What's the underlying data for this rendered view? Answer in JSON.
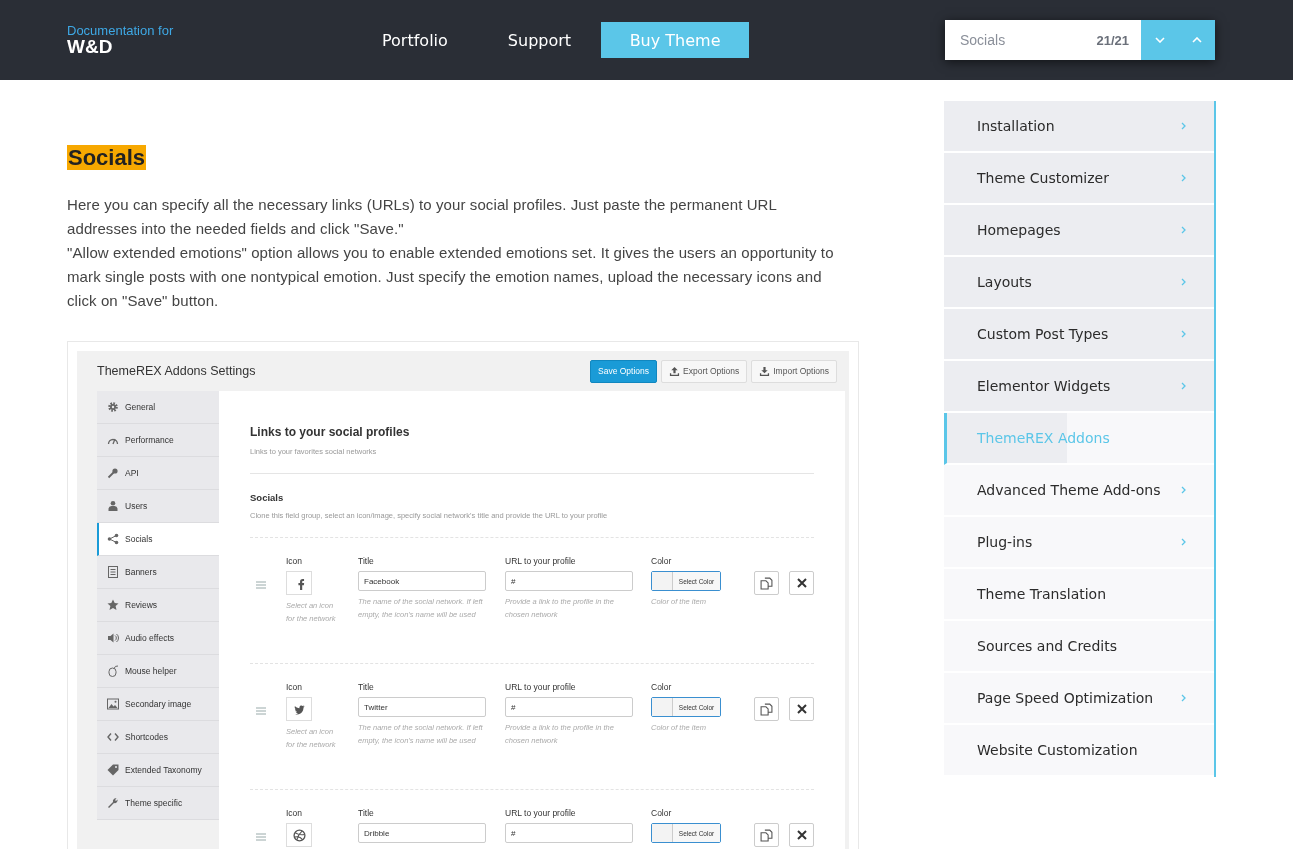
{
  "header": {
    "logo": {
      "caption": "Documentation for",
      "name": "W&D"
    },
    "nav": [
      {
        "label": "Portfolio",
        "kind": "link"
      },
      {
        "label": "Support",
        "kind": "link"
      },
      {
        "label": "Buy Theme",
        "kind": "button"
      }
    ],
    "search": {
      "value": "Socials",
      "count": "21/21"
    }
  },
  "article": {
    "heading": "Socials",
    "paragraphs": [
      "Here you can specify all the necessary links (URLs) to your social profiles. Just paste the permanent URL addresses into the needed fields and click \"Save.\"",
      "\"Allow extended emotions\" option allows you to enable extended emotions set. It gives the users an opportunity to mark single posts with one nontypical emotion. Just specify the emotion names, upload the necessary icons and click on \"Save\" button."
    ]
  },
  "settings": {
    "title": "ThemeREX Addons Settings",
    "buttons": [
      {
        "label": "Save Options",
        "kind": "primary"
      },
      {
        "label": "Export Options",
        "kind": "export"
      },
      {
        "label": "Import Options",
        "kind": "import"
      }
    ],
    "menu": [
      {
        "label": "General",
        "selected": false
      },
      {
        "label": "Performance",
        "selected": false
      },
      {
        "label": "API",
        "selected": false
      },
      {
        "label": "Users",
        "selected": false
      },
      {
        "label": "Socials",
        "selected": true
      },
      {
        "label": "Banners",
        "selected": false
      },
      {
        "label": "Reviews",
        "selected": false
      },
      {
        "label": "Audio effects",
        "selected": false
      },
      {
        "label": "Mouse helper",
        "selected": false
      },
      {
        "label": "Secondary image",
        "selected": false
      },
      {
        "label": "Shortcodes",
        "selected": false
      },
      {
        "label": "Extended Taxonomy",
        "selected": false
      },
      {
        "label": "Theme specific",
        "selected": false
      }
    ],
    "section": {
      "title": "Links to your social profiles",
      "subtitle": "Links to your favorites social networks"
    },
    "group": {
      "title": "Socials",
      "description": "Clone this field group, select an icon/image, specify social network's title and provide the URL to your profile"
    },
    "rows": [
      {
        "icon_label": "Icon",
        "icon_hint": "Select an icon for the network",
        "title_label": "Title",
        "title_value": "Facebook",
        "title_hint": "The name of the social network. If left empty, the icon's name will be used",
        "url_label": "URL to your profile",
        "url_value": "#",
        "url_hint": "Provide a link to the profile in the chosen network",
        "color_label": "Color",
        "color_button": "Select Color",
        "color_hint": "Color of the item"
      },
      {
        "icon_label": "Icon",
        "icon_hint": "Select an icon for the network",
        "title_label": "Title",
        "title_value": "Twitter",
        "title_hint": "The name of the social network. If left empty, the icon's name will be used",
        "url_label": "URL to your profile",
        "url_value": "#",
        "url_hint": "Provide a link to the profile in the chosen network",
        "color_label": "Color",
        "color_button": "Select Color",
        "color_hint": "Color of the item"
      },
      {
        "icon_label": "Icon",
        "title_label": "Title",
        "title_value": "Dribble",
        "url_label": "URL to your profile",
        "url_value": "#",
        "color_label": "Color",
        "color_button": "Select Color"
      }
    ]
  },
  "sidebar": {
    "items": [
      {
        "label": "Installation",
        "has_children": true,
        "visited": true,
        "selected": false
      },
      {
        "label": "Theme Customizer",
        "has_children": true,
        "visited": true,
        "selected": false
      },
      {
        "label": "Homepages",
        "has_children": true,
        "visited": true,
        "selected": false
      },
      {
        "label": "Layouts",
        "has_children": true,
        "visited": true,
        "selected": false
      },
      {
        "label": "Custom Post Types",
        "has_children": true,
        "visited": true,
        "selected": false
      },
      {
        "label": "Elementor Widgets",
        "has_children": true,
        "visited": true,
        "selected": false
      },
      {
        "label": "ThemeREX Addons",
        "has_children": false,
        "visited": false,
        "selected": true,
        "level": 0.45
      },
      {
        "label": "Advanced Theme Add-ons",
        "has_children": true,
        "visited": false,
        "selected": false
      },
      {
        "label": "Plug-ins",
        "has_children": true,
        "visited": false,
        "selected": false
      },
      {
        "label": "Theme Translation",
        "has_children": false,
        "visited": false,
        "selected": false
      },
      {
        "label": "Sources and Credits",
        "has_children": false,
        "visited": false,
        "selected": false
      },
      {
        "label": "Page Speed Optimization",
        "has_children": true,
        "visited": false,
        "selected": false
      },
      {
        "label": "Website Customization",
        "has_children": false,
        "visited": false,
        "selected": false
      }
    ]
  }
}
